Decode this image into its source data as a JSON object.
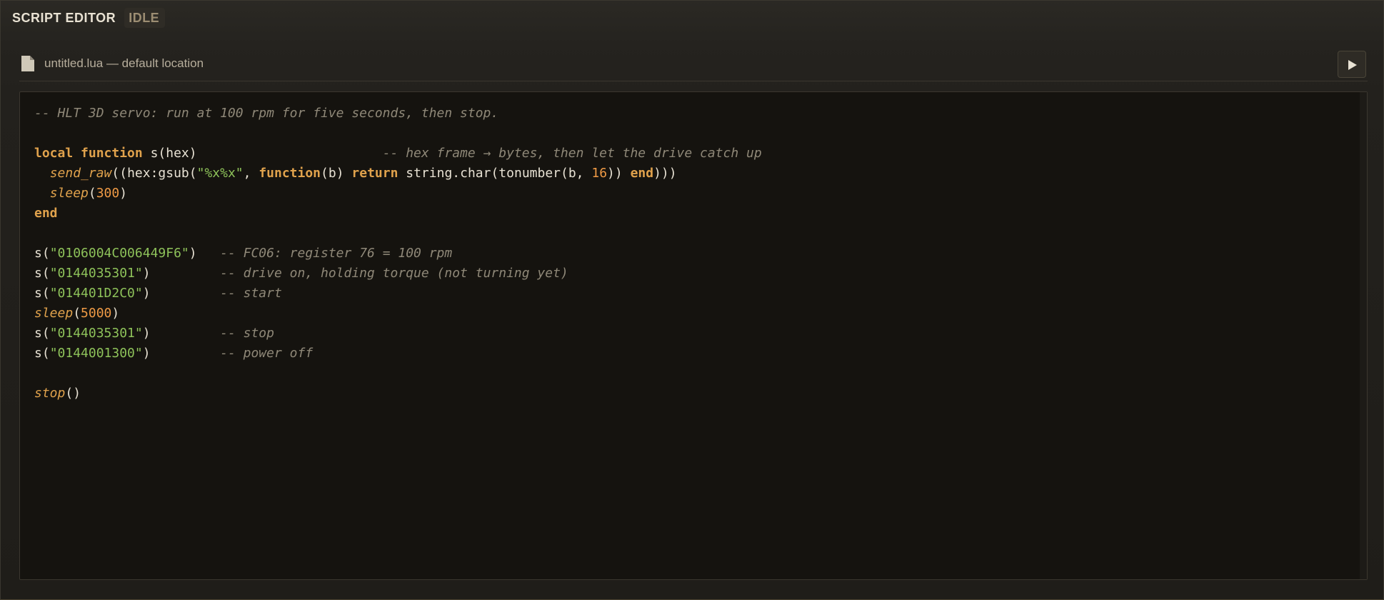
{
  "app": {
    "title": "SCRIPT EDITOR",
    "status": "IDLE"
  },
  "file": {
    "name": "untitled.lua — default location",
    "icon": "file-icon"
  },
  "run_button": {
    "icon": "play-icon"
  },
  "colors": {
    "keyword": "#e0a24c",
    "string": "#8ec25a",
    "number": "#ef9a45",
    "comment": "#8f8878",
    "text": "#e8e2d4",
    "editor_bg": "#15130f"
  },
  "code": {
    "lines": [
      [
        {
          "t": "cm",
          "v": "-- HLT 3D servo: run at 100 rpm for five seconds, then stop."
        }
      ],
      [],
      [
        {
          "t": "kw",
          "v": "local"
        },
        {
          "t": "pl",
          "v": " "
        },
        {
          "t": "kw",
          "v": "function"
        },
        {
          "t": "pl",
          "v": " s(hex)                        "
        },
        {
          "t": "cm",
          "v": "-- hex frame → bytes, then let the drive catch up"
        }
      ],
      [
        {
          "t": "pl",
          "v": "  "
        },
        {
          "t": "fn",
          "v": "send_raw"
        },
        {
          "t": "pl",
          "v": "((hex:gsub("
        },
        {
          "t": "str",
          "v": "\"%x%x\""
        },
        {
          "t": "pl",
          "v": ", "
        },
        {
          "t": "kw",
          "v": "function"
        },
        {
          "t": "pl",
          "v": "(b) "
        },
        {
          "t": "kw",
          "v": "return"
        },
        {
          "t": "pl",
          "v": " string.char(tonumber(b, "
        },
        {
          "t": "num",
          "v": "16"
        },
        {
          "t": "pl",
          "v": ")) "
        },
        {
          "t": "kw",
          "v": "end"
        },
        {
          "t": "pl",
          "v": ")))"
        }
      ],
      [
        {
          "t": "pl",
          "v": "  "
        },
        {
          "t": "fn",
          "v": "sleep"
        },
        {
          "t": "pl",
          "v": "("
        },
        {
          "t": "num",
          "v": "300"
        },
        {
          "t": "pl",
          "v": ")"
        }
      ],
      [
        {
          "t": "kw",
          "v": "end"
        }
      ],
      [],
      [
        {
          "t": "pl",
          "v": "s("
        },
        {
          "t": "str",
          "v": "\"0106004C006449F6\""
        },
        {
          "t": "pl",
          "v": ")   "
        },
        {
          "t": "cm",
          "v": "-- FC06: register 76 = 100 rpm"
        }
      ],
      [
        {
          "t": "pl",
          "v": "s("
        },
        {
          "t": "str",
          "v": "\"0144035301\""
        },
        {
          "t": "pl",
          "v": ")         "
        },
        {
          "t": "cm",
          "v": "-- drive on, holding torque (not turning yet)"
        }
      ],
      [
        {
          "t": "pl",
          "v": "s("
        },
        {
          "t": "str",
          "v": "\"014401D2C0\""
        },
        {
          "t": "pl",
          "v": ")         "
        },
        {
          "t": "cm",
          "v": "-- start"
        }
      ],
      [
        {
          "t": "fn",
          "v": "sleep"
        },
        {
          "t": "pl",
          "v": "("
        },
        {
          "t": "num",
          "v": "5000"
        },
        {
          "t": "pl",
          "v": ")"
        }
      ],
      [
        {
          "t": "pl",
          "v": "s("
        },
        {
          "t": "str",
          "v": "\"0144035301\""
        },
        {
          "t": "pl",
          "v": ")         "
        },
        {
          "t": "cm",
          "v": "-- stop"
        }
      ],
      [
        {
          "t": "pl",
          "v": "s("
        },
        {
          "t": "str",
          "v": "\"0144001300\""
        },
        {
          "t": "pl",
          "v": ")         "
        },
        {
          "t": "cm",
          "v": "-- power off"
        }
      ],
      [],
      [
        {
          "t": "fn",
          "v": "stop"
        },
        {
          "t": "pl",
          "v": "()"
        }
      ]
    ]
  }
}
